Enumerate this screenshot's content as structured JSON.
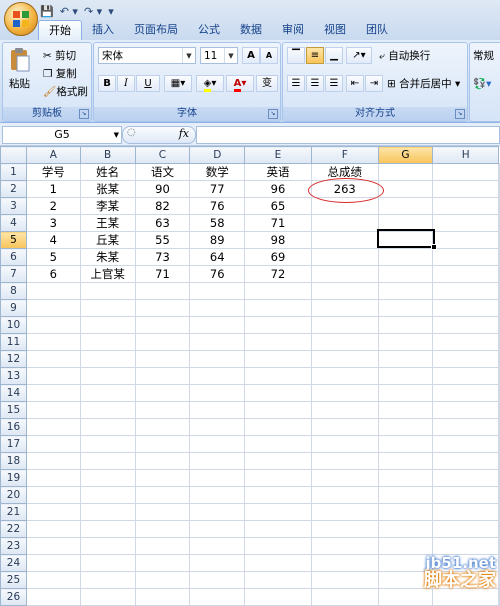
{
  "qat": {
    "save": "💾",
    "undo": "↶ ▾",
    "redo": "↷ ▾",
    "more": "▾"
  },
  "tabs": [
    "开始",
    "插入",
    "页面布局",
    "公式",
    "数据",
    "审阅",
    "视图",
    "团队"
  ],
  "clipboard": {
    "paste": "粘贴",
    "cut": "剪切",
    "copy": "复制",
    "format_painter": "格式刷",
    "group": "剪贴板"
  },
  "font": {
    "name": "宋体",
    "size": "11",
    "grow": "A",
    "shrink": "A",
    "bold": "B",
    "italic": "I",
    "underline": "U",
    "pinyin": "变",
    "group": "字体"
  },
  "alignment": {
    "wrap": "自动换行",
    "merge": "合并后居中",
    "group": "对齐方式"
  },
  "number": {
    "format": "常规"
  },
  "namebox": "G5",
  "fx": "fx",
  "columns": [
    "A",
    "B",
    "C",
    "D",
    "E",
    "F",
    "G",
    "H"
  ],
  "rows": [
    [
      "学号",
      "姓名",
      "语文",
      "数学",
      "英语",
      "总成绩",
      "",
      ""
    ],
    [
      "1",
      "张某",
      "90",
      "77",
      "96",
      "263",
      "",
      ""
    ],
    [
      "2",
      "李某",
      "82",
      "76",
      "65",
      "",
      "",
      ""
    ],
    [
      "3",
      "王某",
      "63",
      "58",
      "71",
      "",
      "",
      ""
    ],
    [
      "4",
      "丘某",
      "55",
      "89",
      "98",
      "",
      "",
      ""
    ],
    [
      "5",
      "朱某",
      "73",
      "64",
      "69",
      "",
      "",
      ""
    ],
    [
      "6",
      "上官某",
      "71",
      "76",
      "72",
      "",
      "",
      ""
    ],
    [
      "",
      "",
      "",
      "",
      "",
      "",
      "",
      ""
    ],
    [
      "",
      "",
      "",
      "",
      "",
      "",
      "",
      ""
    ],
    [
      "",
      "",
      "",
      "",
      "",
      "",
      "",
      ""
    ],
    [
      "",
      "",
      "",
      "",
      "",
      "",
      "",
      ""
    ],
    [
      "",
      "",
      "",
      "",
      "",
      "",
      "",
      ""
    ],
    [
      "",
      "",
      "",
      "",
      "",
      "",
      "",
      ""
    ],
    [
      "",
      "",
      "",
      "",
      "",
      "",
      "",
      ""
    ],
    [
      "",
      "",
      "",
      "",
      "",
      "",
      "",
      ""
    ],
    [
      "",
      "",
      "",
      "",
      "",
      "",
      "",
      ""
    ],
    [
      "",
      "",
      "",
      "",
      "",
      "",
      "",
      ""
    ],
    [
      "",
      "",
      "",
      "",
      "",
      "",
      "",
      ""
    ],
    [
      "",
      "",
      "",
      "",
      "",
      "",
      "",
      ""
    ],
    [
      "",
      "",
      "",
      "",
      "",
      "",
      "",
      ""
    ],
    [
      "",
      "",
      "",
      "",
      "",
      "",
      "",
      ""
    ],
    [
      "",
      "",
      "",
      "",
      "",
      "",
      "",
      ""
    ],
    [
      "",
      "",
      "",
      "",
      "",
      "",
      "",
      ""
    ],
    [
      "",
      "",
      "",
      "",
      "",
      "",
      "",
      ""
    ],
    [
      "",
      "",
      "",
      "",
      "",
      "",
      "",
      ""
    ],
    [
      "",
      "",
      "",
      "",
      "",
      "",
      "",
      ""
    ]
  ],
  "selected_column": "G",
  "selected_row": 5,
  "watermark": {
    "site": "jb51.net",
    "name": "脚本之家"
  }
}
